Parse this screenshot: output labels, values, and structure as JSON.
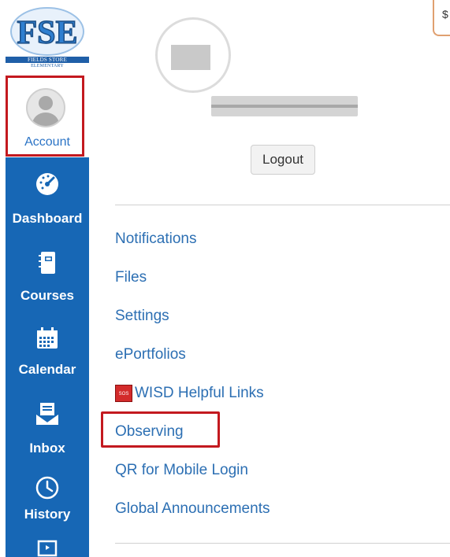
{
  "logo": {
    "letters": "FSE",
    "subtitle_line1": "FIELDS STORE",
    "subtitle_line2": "ELEMENTARY"
  },
  "nav": {
    "account_label": "Account",
    "items": [
      {
        "label": "Dashboard",
        "icon": "dashboard-gauge-icon"
      },
      {
        "label": "Courses",
        "icon": "courses-book-icon"
      },
      {
        "label": "Calendar",
        "icon": "calendar-icon"
      },
      {
        "label": "Inbox",
        "icon": "inbox-icon"
      },
      {
        "label": "History",
        "icon": "clock-history-icon"
      }
    ],
    "partial_icon": "monitor-icon"
  },
  "profile": {
    "logout_label": "Logout"
  },
  "menu": {
    "notifications": "Notifications",
    "files": "Files",
    "settings": "Settings",
    "eportfolios": "ePortfolios",
    "wisd_links": "WISD Helpful Links",
    "wisd_badge": "SOS",
    "observing": "Observing",
    "qr_login": "QR for Mobile Login",
    "global_announcements": "Global Announcements"
  },
  "colors": {
    "nav_bg": "#1767b5",
    "link": "#2c6fb3",
    "highlight": "#c3191f"
  }
}
